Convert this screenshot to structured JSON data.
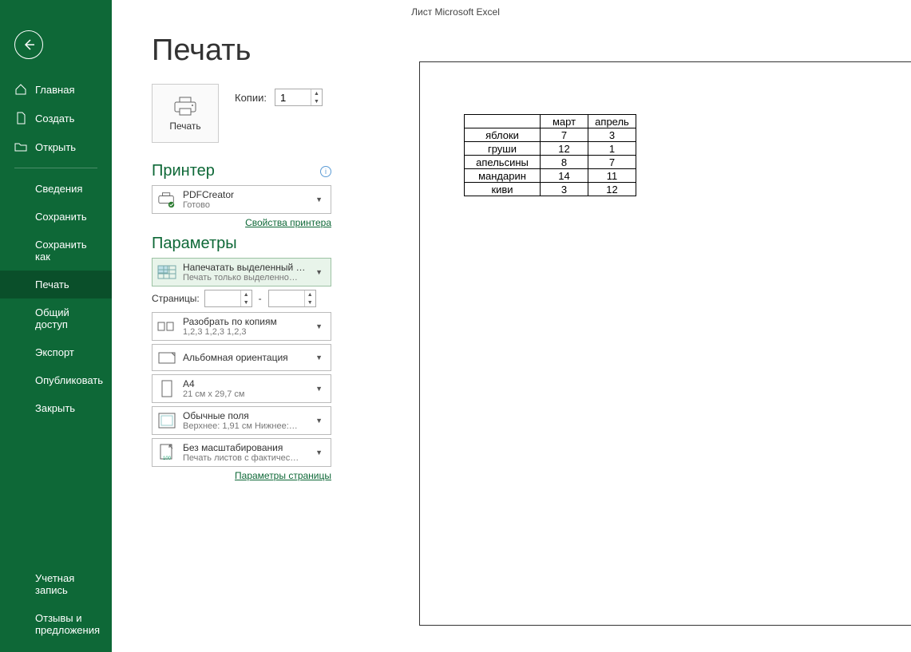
{
  "title_bar": "Лист Microsoft Excel",
  "page_title": "Печать",
  "sidebar": {
    "items": [
      {
        "label": "Главная"
      },
      {
        "label": "Создать"
      },
      {
        "label": "Открыть"
      },
      {
        "label": "Сведения"
      },
      {
        "label": "Сохранить"
      },
      {
        "label": "Сохранить как"
      },
      {
        "label": "Печать"
      },
      {
        "label": "Общий доступ"
      },
      {
        "label": "Экспорт"
      },
      {
        "label": "Опубликовать"
      },
      {
        "label": "Закрыть"
      }
    ],
    "bottom": [
      {
        "label": "Учетная запись"
      },
      {
        "label": "Отзывы и предложения"
      }
    ]
  },
  "print_button_label": "Печать",
  "copies_label": "Копии:",
  "copies_value": "1",
  "printer_section": "Принтер",
  "printer": {
    "name": "PDFCreator",
    "status": "Готово"
  },
  "printer_props_link": "Свойства принтера",
  "settings_section": "Параметры",
  "pages_label": "Страницы:",
  "pages_from": "",
  "pages_to": "",
  "settings": {
    "print_what": {
      "line1": "Напечатать выделенный ф…",
      "line2": "Печать только выделенно…"
    },
    "collate": {
      "line1": "Разобрать по копиям",
      "line2": "1,2,3    1,2,3    1,2,3"
    },
    "orient": {
      "line1": "Альбомная ориентация",
      "line2": ""
    },
    "paper": {
      "line1": "A4",
      "line2": "21 см x 29,7 см"
    },
    "margins": {
      "line1": "Обычные поля",
      "line2": "Верхнее: 1,91 см Нижнее:…"
    },
    "scale": {
      "line1": "Без масштабирования",
      "line2": "Печать листов с фактичес…"
    }
  },
  "page_setup_link": "Параметры страницы",
  "chart_data": {
    "type": "table",
    "columns": [
      "",
      "март",
      "апрель"
    ],
    "rows": [
      [
        "яблоки",
        "7",
        "3"
      ],
      [
        "груши",
        "12",
        "1"
      ],
      [
        "апельсины",
        "8",
        "7"
      ],
      [
        "мандарин",
        "14",
        "11"
      ],
      [
        "киви",
        "3",
        "12"
      ]
    ]
  }
}
